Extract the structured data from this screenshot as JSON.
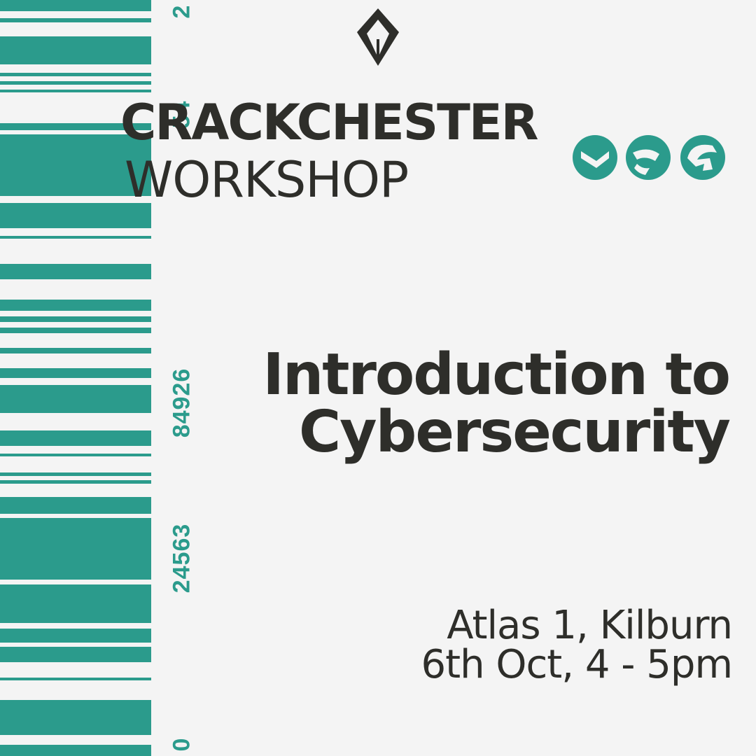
{
  "brand": {
    "title": "CRACKCHESTER",
    "subtitle": "WORKSHOP",
    "logo_icon": "pen-nib-icon",
    "partner_logo_icon": "ess-partner-logo"
  },
  "event": {
    "title_line1": "Introduction to",
    "title_line2": "Cybersecurity",
    "location": "Atlas 1, Kilburn",
    "datetime": "6th Oct, 4 - 5pm"
  },
  "barcode": {
    "digits": [
      "2",
      "54",
      "84926",
      "24563",
      "0"
    ]
  },
  "colors": {
    "accent": "#2b9b8c",
    "text": "#2e2e2a",
    "background": "#f4f4f4"
  }
}
